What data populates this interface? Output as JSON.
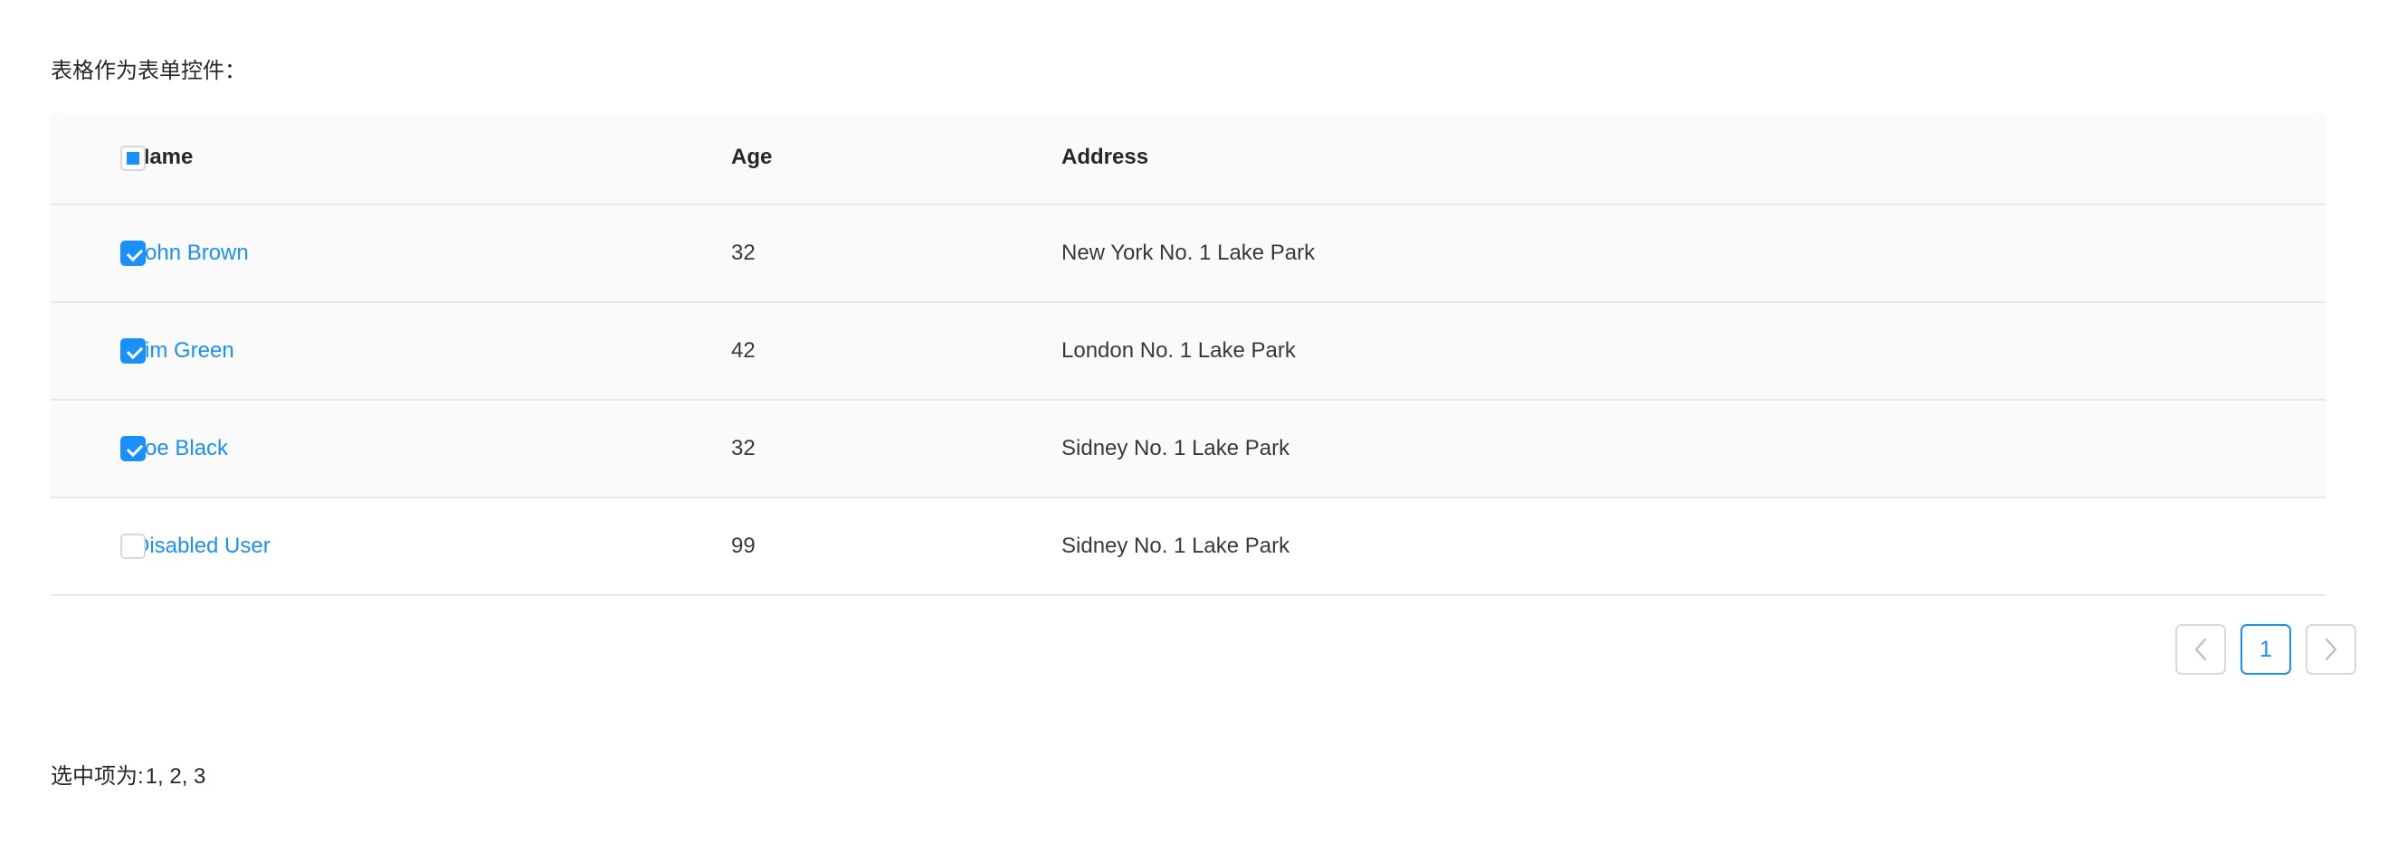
{
  "caption": "表格作为表单控件：",
  "table": {
    "select_all_checkbox": {
      "state": "indeterminate",
      "name": "select-all-checkbox"
    },
    "columns": [
      {
        "key": "selection",
        "label": ""
      },
      {
        "key": "name",
        "label": "Name"
      },
      {
        "key": "age",
        "label": "Age"
      },
      {
        "key": "address",
        "label": "Address"
      }
    ],
    "rows": [
      {
        "selected": true,
        "checkbox_state": "checked",
        "name": "John Brown",
        "age": "32",
        "address": "New York No. 1 Lake Park"
      },
      {
        "selected": true,
        "checkbox_state": "checked",
        "name": "Jim Green",
        "age": "42",
        "address": "London No. 1 Lake Park"
      },
      {
        "selected": true,
        "checkbox_state": "checked",
        "name": "Joe Black",
        "age": "32",
        "address": "Sidney No. 1 Lake Park"
      },
      {
        "selected": false,
        "checkbox_state": "unchecked",
        "name": "Disabled User",
        "age": "99",
        "address": "Sidney No. 1 Lake Park"
      }
    ]
  },
  "pagination": {
    "prev_label": "‹",
    "prev_icon": "chevron-left-icon",
    "next_label": "›",
    "next_icon": "chevron-right-icon",
    "pages": [
      "1"
    ],
    "current_page": "1"
  },
  "status": {
    "label": "选中项为:",
    "values": "1, 2, 3"
  },
  "colors": {
    "accent": "#1890ff",
    "link": "#1890ff",
    "header_bg": "#fafafa",
    "selected_row_bg": "#fafafa",
    "border": "#e8e8e8",
    "checkbox_border": "#d9d9d9",
    "disabled_text": "#bfbfbf"
  }
}
